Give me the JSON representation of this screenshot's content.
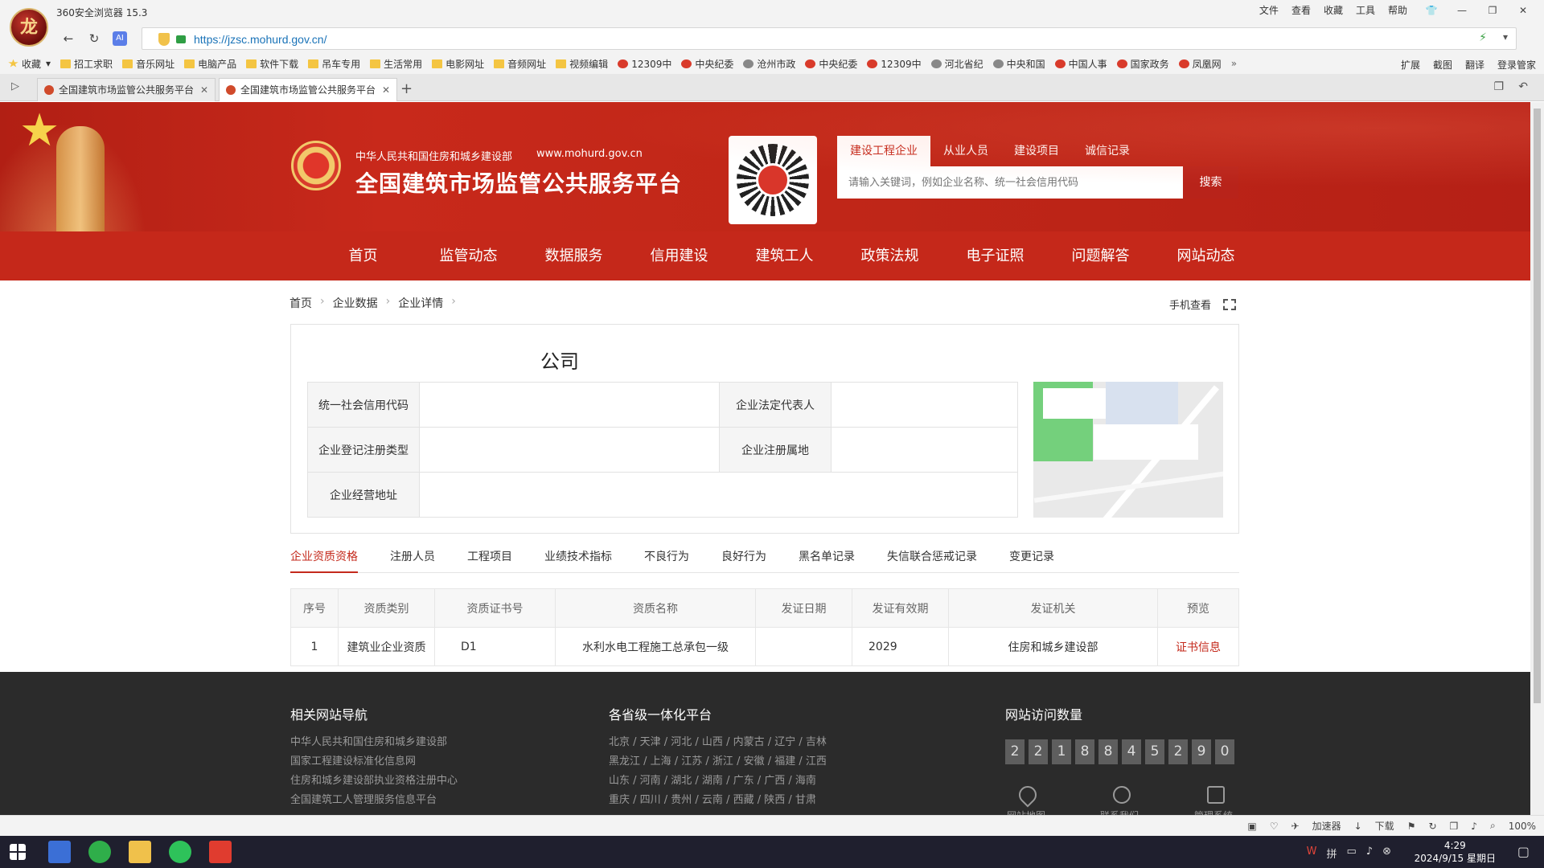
{
  "browser": {
    "title": "360安全浏览器 15.3",
    "menu": [
      "文件",
      "查看",
      "收藏",
      "工具",
      "帮助"
    ],
    "url": "https://jzsc.mohurd.gov.cn/",
    "bookmarks": [
      "收藏",
      "招工求职",
      "音乐网址",
      "电脑产品",
      "软件下载",
      "吊车专用",
      "生活常用",
      "电影网址",
      "音频网址",
      "视频编辑",
      "12309中",
      "中央纪委",
      "沧州市政",
      "中央纪委",
      "12309中",
      "河北省纪",
      "中央和国",
      "中国人事",
      "国家政务",
      "凤凰网"
    ],
    "bookmark_right": [
      "扩展",
      "截图",
      "翻译",
      "登录管家"
    ],
    "tabs": [
      "全国建筑市场监管公共服务平台",
      "全国建筑市场监管公共服务平台"
    ],
    "statusbar": [
      "加速器",
      "下载",
      "100%"
    ]
  },
  "header": {
    "ministry": "中华人民共和国住房和城乡建设部",
    "ministry_url": "www.mohurd.gov.cn",
    "site_title": "全国建筑市场监管公共服务平台",
    "search_tabs": [
      "建设工程企业",
      "从业人员",
      "建设项目",
      "诚信记录"
    ],
    "search_placeholder": "请输入关键词，例如企业名称、统一社会信用代码",
    "search_button": "搜索"
  },
  "nav": [
    "首页",
    "监管动态",
    "数据服务",
    "信用建设",
    "建筑工人",
    "政策法规",
    "电子证照",
    "问题解答",
    "网站动态"
  ],
  "breadcrumb": [
    "首页",
    "企业数据",
    "企业详情"
  ],
  "mobile_view": "手机查看",
  "company": {
    "name": "公司",
    "labels": {
      "credit_code": "统一社会信用代码",
      "legal_rep": "企业法定代表人",
      "reg_type": "企业登记注册类型",
      "reg_place": "企业注册属地",
      "address": "企业经营地址"
    }
  },
  "detail_tabs": [
    "企业资质资格",
    "注册人员",
    "工程项目",
    "业绩技术指标",
    "不良行为",
    "良好行为",
    "黑名单记录",
    "失信联合惩戒记录",
    "变更记录"
  ],
  "qual_table": {
    "headers": [
      "序号",
      "资质类别",
      "资质证书号",
      "资质名称",
      "发证日期",
      "发证有效期",
      "发证机关",
      "预览"
    ],
    "rows": [
      [
        "1",
        "建筑业企业资质",
        "D1",
        "水利水电工程施工总承包一级",
        "",
        "2029",
        "住房和城乡建设部",
        "证书信息"
      ]
    ]
  },
  "footer": {
    "nav_title": "相关网站导航",
    "nav_links": [
      "中华人民共和国住房和城乡建设部",
      "国家工程建设标准化信息网",
      "住房和城乡建设部执业资格注册中心",
      "全国建筑工人管理服务信息平台"
    ],
    "province_title": "各省级一体化平台",
    "province_lines": [
      "北京 / 天津 / 河北 / 山西 / 内蒙古 / 辽宁 / 吉林",
      "黑龙江 / 上海 / 江苏 / 浙江 / 安徽 / 福建 / 江西",
      "山东 / 河南 / 湖北 / 湖南 / 广东 / 广西 / 海南",
      "重庆 / 四川 / 贵州 / 云南 / 西藏 / 陕西 / 甘肃"
    ],
    "visits_title": "网站访问数量",
    "visit_digits": [
      "2",
      "2",
      "1",
      "8",
      "8",
      "4",
      "5",
      "2",
      "9",
      "0"
    ],
    "bottom_links": [
      "网站地图",
      "联系我们",
      "管理系统"
    ]
  },
  "taskbar": {
    "time": "4:29",
    "date": "2024/9/15 星期日"
  }
}
